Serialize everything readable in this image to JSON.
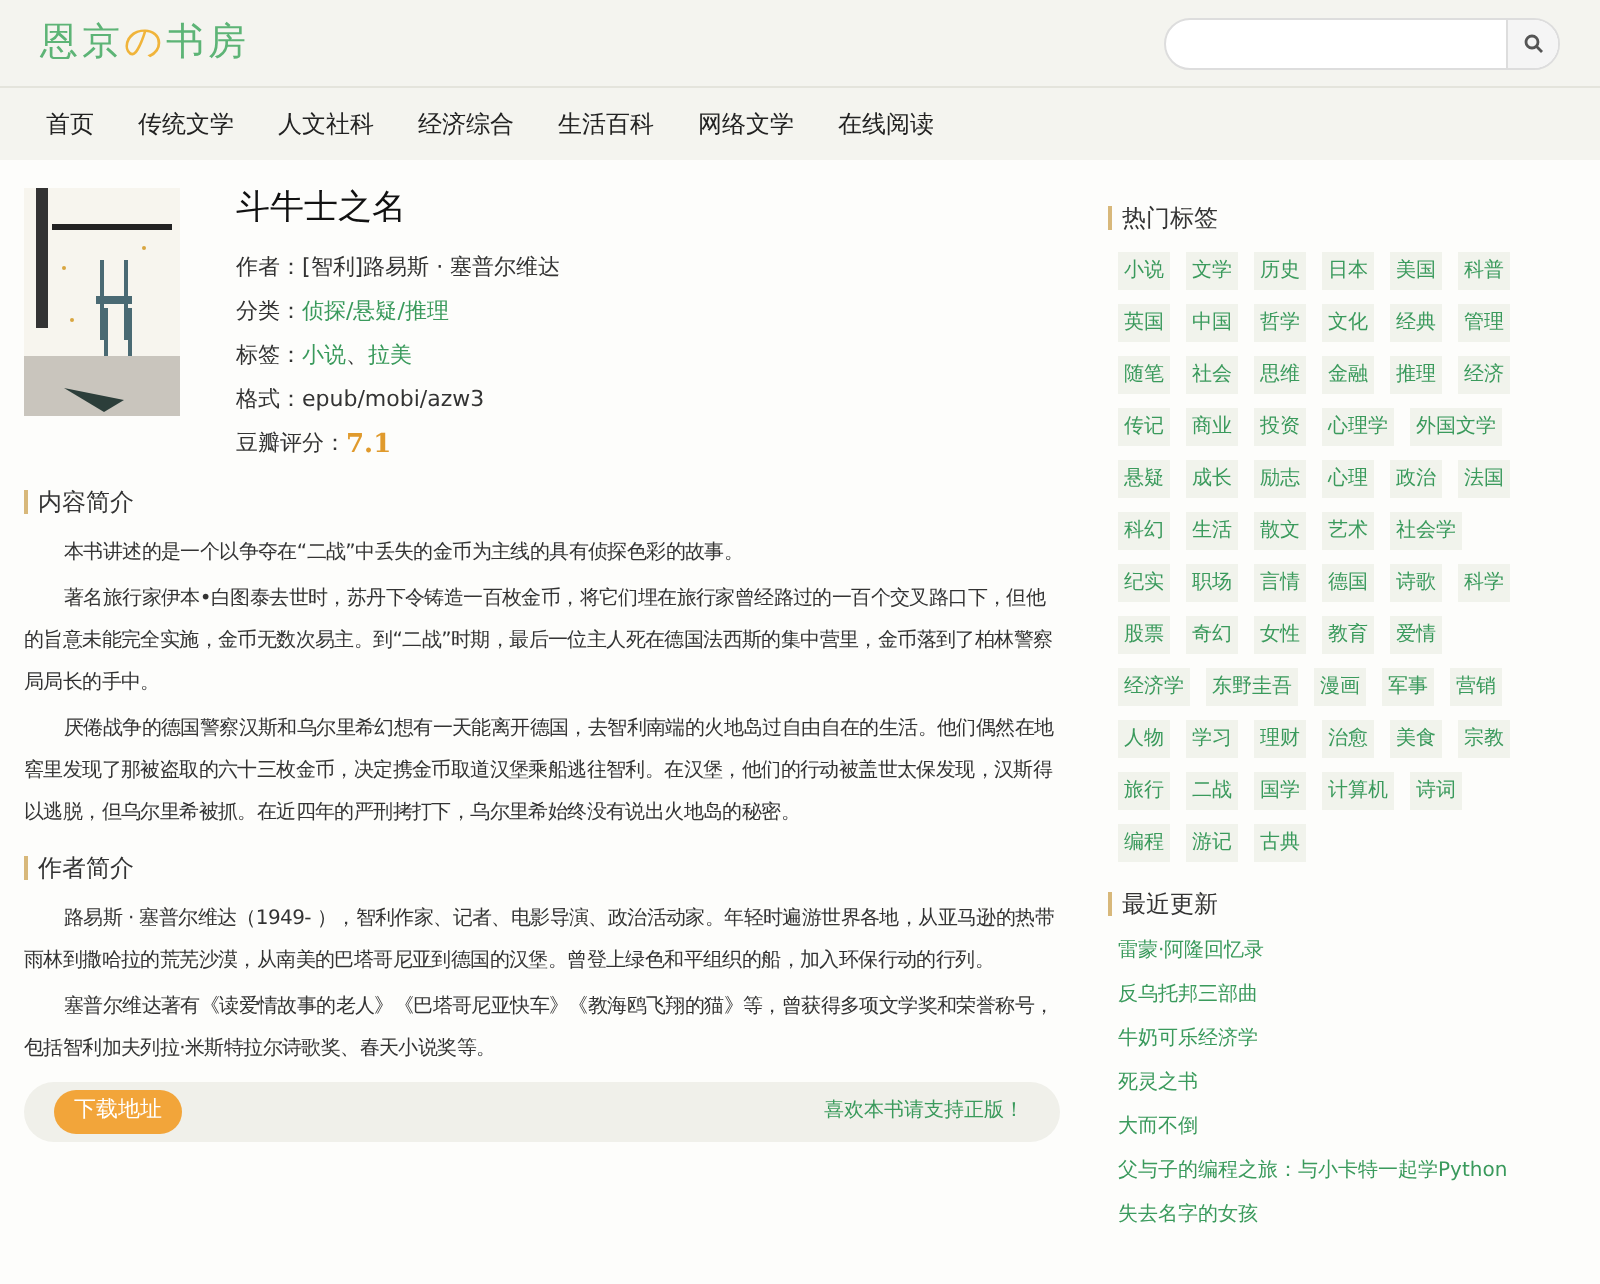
{
  "logo": {
    "parts": [
      {
        "text": "恩京",
        "kind": "main"
      },
      {
        "text": "の",
        "kind": "accent"
      },
      {
        "text": "书房",
        "kind": "main"
      }
    ]
  },
  "nav": [
    "首页",
    "传统文学",
    "人文社科",
    "经济综合",
    "生活百科",
    "网络文学",
    "在线阅读"
  ],
  "book": {
    "title": "斗牛士之名",
    "fields": [
      {
        "label": "作者：",
        "kind": "plain",
        "values": [
          "[智利]路易斯 · 塞普尔维达"
        ]
      },
      {
        "label": "分类：",
        "kind": "link",
        "values": [
          "侦探/悬疑/推理"
        ]
      },
      {
        "label": "标签：",
        "kind": "links",
        "values": [
          "小说",
          "拉美"
        ],
        "separator": "、"
      },
      {
        "label": "格式：",
        "kind": "plain",
        "values": [
          "epub/mobi/azw3"
        ]
      },
      {
        "label": "豆瓣评分：",
        "kind": "score",
        "values": [
          "7.1"
        ]
      }
    ]
  },
  "sections": [
    {
      "heading": "内容简介",
      "paragraphs": [
        "本书讲述的是一个以争夺在“二战”中丢失的金币为主线的具有侦探色彩的故事。",
        "著名旅行家伊本•白图泰去世时，苏丹下令铸造一百枚金币，将它们埋在旅行家曾经路过的一百个交叉路口下，但他的旨意未能完全实施，金币无数次易主。到“二战”时期，最后一位主人死在德国法西斯的集中营里，金币落到了柏林警察局局长的手中。",
        "厌倦战争的德国警察汉斯和乌尔里希幻想有一天能离开德国，去智利南端的火地岛过自由自在的生活。他们偶然在地窖里发现了那被盗取的六十三枚金币，决定携金币取道汉堡乘船逃往智利。在汉堡，他们的行动被盖世太保发现，汉斯得以逃脱，但乌尔里希被抓。在近四年的严刑拷打下，乌尔里希始终没有说出火地岛的秘密。"
      ]
    },
    {
      "heading": "作者简介",
      "paragraphs": [
        "路易斯 · 塞普尔维达（1949- ），智利作家、记者、电影导演、政治活动家。年轻时遍游世界各地，从亚马逊的热带雨林到撒哈拉的荒芜沙漠，从南美的巴塔哥尼亚到德国的汉堡。曾登上绿色和平组织的船，加入环保行动的行列。",
        "塞普尔维达著有《读爱情故事的老人》《巴塔哥尼亚快车》《教海鸥飞翔的猫》等，曾获得多项文学奖和荣誉称号，包括智利加夫列拉·米斯特拉尔诗歌奖、春天小说奖等。"
      ]
    }
  ],
  "download": {
    "button": "下载地址",
    "note": "喜欢本书请支持正版！"
  },
  "hot_tags": {
    "heading": "热门标签",
    "tags": [
      "小说",
      "文学",
      "历史",
      "日本",
      "美国",
      "科普",
      "英国",
      "中国",
      "哲学",
      "文化",
      "经典",
      "管理",
      "随笔",
      "社会",
      "思维",
      "金融",
      "推理",
      "经济",
      "传记",
      "商业",
      "投资",
      "心理学",
      "外国文学",
      "悬疑",
      "成长",
      "励志",
      "心理",
      "政治",
      "法国",
      "科幻",
      "生活",
      "散文",
      "艺术",
      "社会学",
      "纪实",
      "职场",
      "言情",
      "德国",
      "诗歌",
      "科学",
      "股票",
      "奇幻",
      "女性",
      "教育",
      "爱情",
      "经济学",
      "东野圭吾",
      "漫画",
      "军事",
      "营销",
      "人物",
      "学习",
      "理财",
      "治愈",
      "美食",
      "宗教",
      "旅行",
      "二战",
      "国学",
      "计算机",
      "诗词",
      "编程",
      "游记",
      "古典"
    ]
  },
  "recent": {
    "heading": "最近更新",
    "items": [
      "雷蒙·阿隆回忆录",
      "反乌托邦三部曲",
      "牛奶可乐经济学",
      "死灵之书",
      "大而不倒",
      "父与子的编程之旅：与小卡特一起学Python",
      "失去名字的女孩"
    ]
  }
}
